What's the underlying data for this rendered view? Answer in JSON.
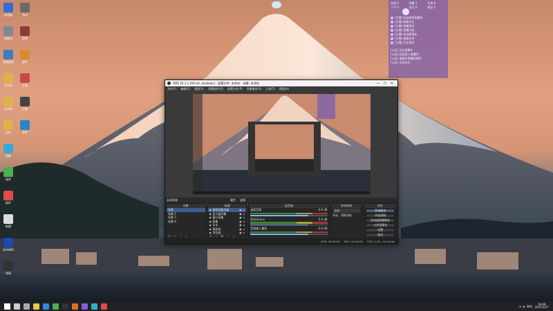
{
  "colors": {
    "accent": "#3d5d8c",
    "panel": "#8060aa",
    "meter_green": "#3b8c3b",
    "meter_yellow": "#a7a73b",
    "meter_red": "#a23b3b"
  },
  "desktop": {
    "icons": [
      {
        "label": "此电脑",
        "icon": "computer-icon"
      },
      {
        "label": "回收站",
        "icon": "recycle-bin-icon"
      },
      {
        "label": "控制面板",
        "icon": "control-panel-icon"
      },
      {
        "label": "文件夹",
        "icon": "folder-icon"
      },
      {
        "label": "文件夹",
        "icon": "folder-icon"
      },
      {
        "label": "文件",
        "icon": "folder-icon"
      },
      {
        "label": "网络",
        "icon": "network-icon"
      },
      {
        "label": "软件",
        "icon": "app-icon"
      },
      {
        "label": "软件",
        "icon": "app-icon"
      },
      {
        "label": "新建",
        "icon": "document-icon"
      },
      {
        "label": "HUAWEI",
        "icon": "huawei-icon"
      },
      {
        "label": "OBS",
        "icon": "obs-icon"
      },
      {
        "label": "Tool",
        "icon": "tool-icon"
      },
      {
        "label": "游戏",
        "icon": "game-icon"
      },
      {
        "label": "软件",
        "icon": "app-icon"
      },
      {
        "label": "工具",
        "icon": "tool-icon"
      },
      {
        "label": "工具",
        "icon": "tool-icon"
      },
      {
        "label": "软件",
        "icon": "app-icon"
      }
    ]
  },
  "stream_panel": {
    "stats": [
      "在线 0",
      "弹幕 1",
      "礼物 0",
      "人气 0",
      "关注 0",
      "粉丝 0"
    ],
    "messages": [
      "[主播] 欢迎来到直播间",
      "[主播] 感谢关注",
      "[主播] 弹幕测试",
      "[主播] 直播开始",
      "[主播] 欢迎新朋友",
      "[主播] 谢谢支持",
      "[主播] 正在测试"
    ],
    "notices": [
      "[公告] 正在直播中",
      "[公告] 欢迎进入直播间",
      "[公告] 请遵守直播间规则",
      "[公告] 点击关注"
    ]
  },
  "obs": {
    "title": "OBS 26.1.1 (64-bit, windows) - 配置文件: 未命名 - 场景: 未命名",
    "window_buttons": {
      "minimize": "—",
      "maximize": "☐",
      "close": "✕"
    },
    "menu": [
      "文件(F)",
      "编辑(E)",
      "视图(V)",
      "停靠部件(D)",
      "配置文件(P)",
      "场景集合(S)",
      "工具(T)",
      "帮助(H)"
    ],
    "source_bar": {
      "label": "未选择源",
      "properties": "属性",
      "filters": "滤镜"
    },
    "scenes": {
      "title": "场景",
      "items": [
        "场景",
        "场景 2",
        "场景 3",
        "场景 4"
      ]
    },
    "sources": {
      "title": "来源",
      "items": [
        "视频采集设备",
        "显示器采集",
        "窗口采集",
        "图像",
        "文本",
        "媒体源",
        "浏览器"
      ]
    },
    "mixer": {
      "title": "混音器",
      "channels": [
        {
          "name": "桌面音频",
          "db": "0.0 dB",
          "volume": 0.75
        },
        {
          "name": "麦克风/Aux",
          "db": "0.0 dB",
          "volume": 0.75
        },
        {
          "name": "音频输入捕获",
          "db": "0.0 dB",
          "volume": 0.75
        }
      ]
    },
    "transitions": {
      "title": "转场特效",
      "type": "淡出",
      "duration_label": "时长",
      "duration": "300 ms"
    },
    "controls": {
      "title": "控件",
      "buttons": [
        "开始推流",
        "开始录制",
        "启动虚拟摄像机",
        "工作室模式",
        "设置",
        "退出"
      ]
    },
    "status": {
      "live": "LIVE: 00:00:00",
      "rec": "REC: 00:00:00",
      "cpu": "CPU: 2.0%, 30.00 fps"
    }
  },
  "taskbar": {
    "time": "19:48",
    "date": "2021/3/27",
    "lang": "ENG",
    "apps": [
      "start-icon",
      "search-icon",
      "task-view-icon",
      "explorer-icon",
      "edge-icon",
      "chrome-icon",
      "obs-icon",
      "app-icon",
      "app-icon",
      "app-icon",
      "app-icon"
    ]
  }
}
